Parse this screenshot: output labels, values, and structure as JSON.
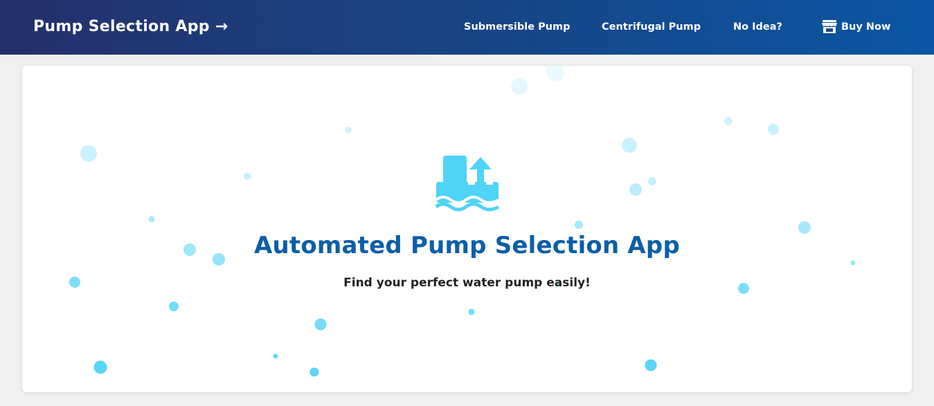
{
  "navbar": {
    "brand": "Pump Selection App →",
    "links": [
      {
        "label": "Submersible Pump"
      },
      {
        "label": "Centrifugal Pump"
      },
      {
        "label": "No Idea?"
      },
      {
        "label": "Buy Now",
        "icon": "store-icon"
      }
    ],
    "colors": {
      "gradient_start": "#23306b",
      "gradient_end": "#0a56a3"
    }
  },
  "hero": {
    "icon": "pump-water-icon",
    "title": "Automated Pump Selection App",
    "subtitle": "Find your perfect water pump easily!",
    "colors": {
      "title": "#0b5ea8",
      "icon": "#4fd3f7",
      "bubble": "#4fd3f7"
    }
  }
}
